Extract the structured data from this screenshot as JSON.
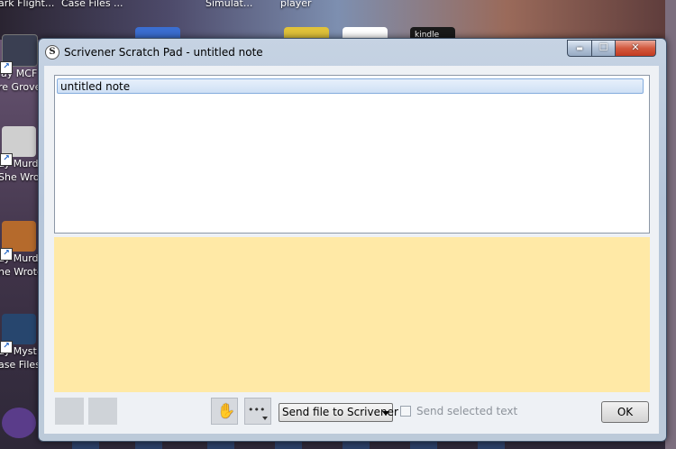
{
  "desktop": {
    "top_labels": [
      "ark Flight...",
      "Case Files ...",
      "Simulat...",
      "player",
      "kindle"
    ],
    "icons": [
      {
        "lines": [
          "lay MCF",
          "re Grove"
        ]
      },
      {
        "lines": [
          "ay Murd",
          "She Wrot"
        ]
      },
      {
        "lines": [
          "ay Murd",
          "he Wrote"
        ]
      },
      {
        "lines": [
          "ay Myst",
          "ase Files"
        ]
      }
    ]
  },
  "window": {
    "title": "Scrivener Scratch Pad - untitled note",
    "app_icon_glyph": "S",
    "caption": {
      "minimize": "▬",
      "maximize": "☐",
      "close": "✕"
    }
  },
  "notes": {
    "items": [
      {
        "label": "untitled note",
        "selected": true
      }
    ]
  },
  "editor": {
    "background": "#ffe9a6",
    "text": ""
  },
  "toolbar": {
    "hand_icon": "✋",
    "more_icon": "•••",
    "send_file_label": "Send file to Scrivener",
    "send_selected_label": "Send selected text",
    "send_selected_checked": false,
    "ok_label": "OK"
  }
}
